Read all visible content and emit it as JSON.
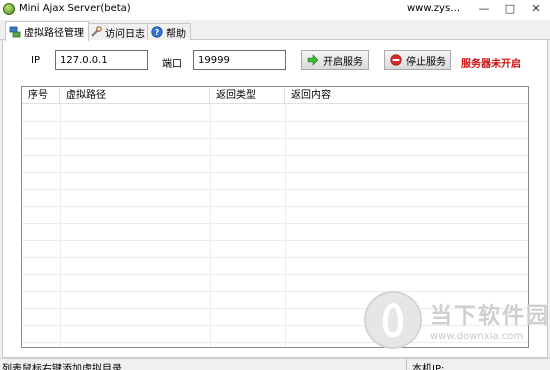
{
  "window": {
    "title": "Mini Ajax Server(beta)",
    "url_text": "www.zys…",
    "controls": [
      "—",
      "□",
      "✕"
    ]
  },
  "tabs": [
    {
      "label": "虚拟路径管理",
      "icon": "network-icon",
      "active": true
    },
    {
      "label": "访问日志",
      "icon": "tools-icon",
      "active": false
    },
    {
      "label": "帮助",
      "icon": "help-icon",
      "active": false
    }
  ],
  "form": {
    "ip_label": "IP",
    "ip_value": "127.0.0.1",
    "port_label": "端口",
    "port_value": "19999",
    "start_button": "开启服务",
    "stop_button": "停止服务",
    "status_text": "服务器未开启",
    "status_color": "#d01010"
  },
  "table": {
    "columns": [
      "序号",
      "虚拟路径",
      "返回类型",
      "返回内容"
    ],
    "rows": []
  },
  "watermark": {
    "text": "当下软件园",
    "url": "www.downxia.com"
  },
  "statusbar": {
    "hint": "列表鼠标右键添加虚拟目录",
    "local_ip_label": "本机IP:"
  }
}
